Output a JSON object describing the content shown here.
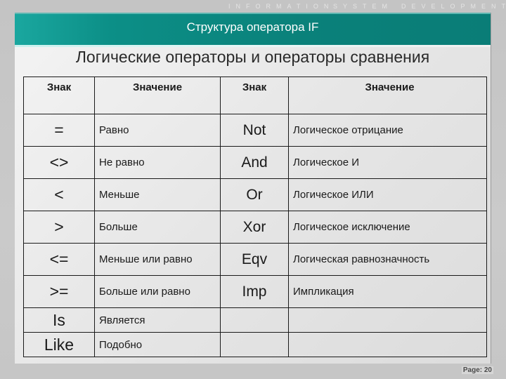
{
  "header": {
    "topline": [
      "INFORMATION",
      "SYSTEM",
      "DEVELOPMENT"
    ],
    "title": "Структура оператора IF"
  },
  "subtitle": "Логические операторы и операторы сравнения",
  "table": {
    "headers": [
      "Знак",
      "Значение",
      "Знак",
      "Значение"
    ],
    "rows": [
      [
        "=",
        "Равно",
        "Not",
        "Логическое отрицание"
      ],
      [
        "<>",
        "Не равно",
        "And",
        "Логическое И"
      ],
      [
        "<",
        "Меньше",
        "Or",
        "Логическое ИЛИ"
      ],
      [
        ">",
        "Больше",
        "Xor",
        "Логическое исключение"
      ],
      [
        "<=",
        "Меньше или равно",
        "Eqv",
        "Логическая равнозначность"
      ],
      [
        ">=",
        "Больше или равно",
        "Imp",
        "Импликация"
      ],
      [
        "Is",
        "Является",
        "",
        ""
      ],
      [
        "Like",
        "Подобно",
        "",
        ""
      ]
    ]
  },
  "footer": {
    "page": "Page: 20"
  },
  "colors": {
    "banner": "#0c8f87",
    "banner_text": "#ffffff",
    "border": "#1a1a1a"
  }
}
